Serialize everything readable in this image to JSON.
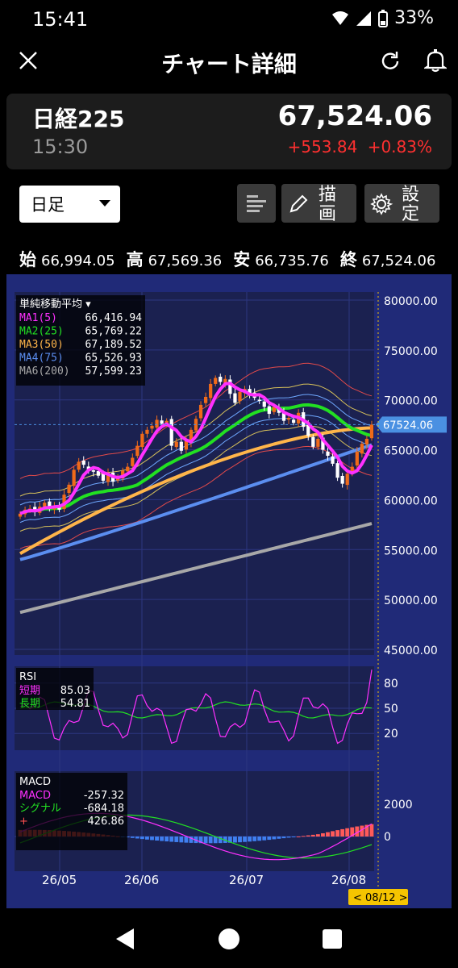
{
  "status_bar": {
    "time": "15:41",
    "battery": "33%"
  },
  "app_bar": {
    "title": "チャート詳細"
  },
  "quote": {
    "name": "日経225",
    "time": "15:30",
    "price": "67,524.06",
    "change": "+553.84",
    "change_pct": "+0.83%"
  },
  "controls": {
    "period": "日足",
    "draw_label": "描画",
    "settings_label": "設定"
  },
  "ohlc": [
    {
      "k": "始",
      "v": "66,994.05"
    },
    {
      "k": "高",
      "v": "67,569.36"
    },
    {
      "k": "安",
      "v": "66,735.76"
    },
    {
      "k": "終",
      "v": "67,524.06"
    }
  ],
  "colors": {
    "chart_bg": "#202a78",
    "up": "#f06a1a",
    "down": "#ffffff",
    "ma1": "#ff30ff",
    "ma2": "#22e022",
    "ma3": "#ffb54a",
    "ma4": "#5b8ef0",
    "ma6": "#a8a8a8",
    "change": "#ff3030",
    "price_tag": "#4a90e2",
    "date_tag": "#f5c400"
  },
  "chart_data": [
    {
      "type": "candlestick",
      "legend_title": "単純移動平均",
      "y_ticks": [
        "80000.00",
        "75000.00",
        "70000.00",
        "65000.00",
        "60000.00",
        "55000.00",
        "50000.00",
        "45000.00"
      ],
      "ylim": [
        45000,
        80000
      ],
      "current_price_tag": "67524.06",
      "x_tick_labels": [
        "26/05",
        "26/06",
        "26/07",
        "26/08"
      ],
      "selected_date": "< 08/12 >",
      "series": [
        {
          "name": "MA1(5)",
          "value": "66,416.94",
          "color": "#ff30ff"
        },
        {
          "name": "MA2(25)",
          "value": "65,769.22",
          "color": "#22e022"
        },
        {
          "name": "MA3(50)",
          "value": "67,189.52",
          "color": "#ffb54a"
        },
        {
          "name": "MA4(75)",
          "value": "65,526.93",
          "color": "#5b8ef0"
        },
        {
          "name": "MA6(200)",
          "value": "57,599.23",
          "color": "#a8a8a8"
        }
      ],
      "close": [
        58600,
        59000,
        59100,
        58800,
        59300,
        59700,
        59200,
        59400,
        59000,
        60500,
        61500,
        63000,
        63800,
        63500,
        63000,
        62800,
        62400,
        61900,
        62700,
        61800,
        62300,
        62900,
        63300,
        64200,
        65400,
        66600,
        67000,
        67400,
        68000,
        67600,
        67900,
        65400,
        65800,
        64900,
        65900,
        67000,
        68100,
        69500,
        70300,
        71600,
        72200,
        71800,
        72100,
        70600,
        69700,
        70800,
        71100,
        70600,
        70200,
        69900,
        69300,
        68600,
        69300,
        68700,
        67900,
        68200,
        67700,
        68700,
        67300,
        66400,
        65300,
        66100,
        65000,
        64400,
        63600,
        62200,
        61600,
        62600,
        63300,
        64800,
        65600,
        66100,
        67524
      ]
    },
    {
      "type": "line",
      "title": "RSI",
      "series": [
        {
          "name": "短期",
          "value": "85.03",
          "color": "#ff30ff"
        },
        {
          "name": "長期",
          "value": "54.81",
          "color": "#22e022"
        }
      ],
      "y_ticks": [
        "80",
        "50",
        "20"
      ],
      "ylim": [
        0,
        100
      ]
    },
    {
      "type": "macd",
      "title": "MACD",
      "series": [
        {
          "name": "MACD",
          "value": "-257.32",
          "color": "#ff30ff"
        },
        {
          "name": "シグナル",
          "value": "-684.18",
          "color": "#22e022"
        },
        {
          "name": "+",
          "value": "426.86",
          "color": "#ff5050"
        }
      ],
      "y_ticks": [
        "2000",
        "0"
      ]
    }
  ]
}
